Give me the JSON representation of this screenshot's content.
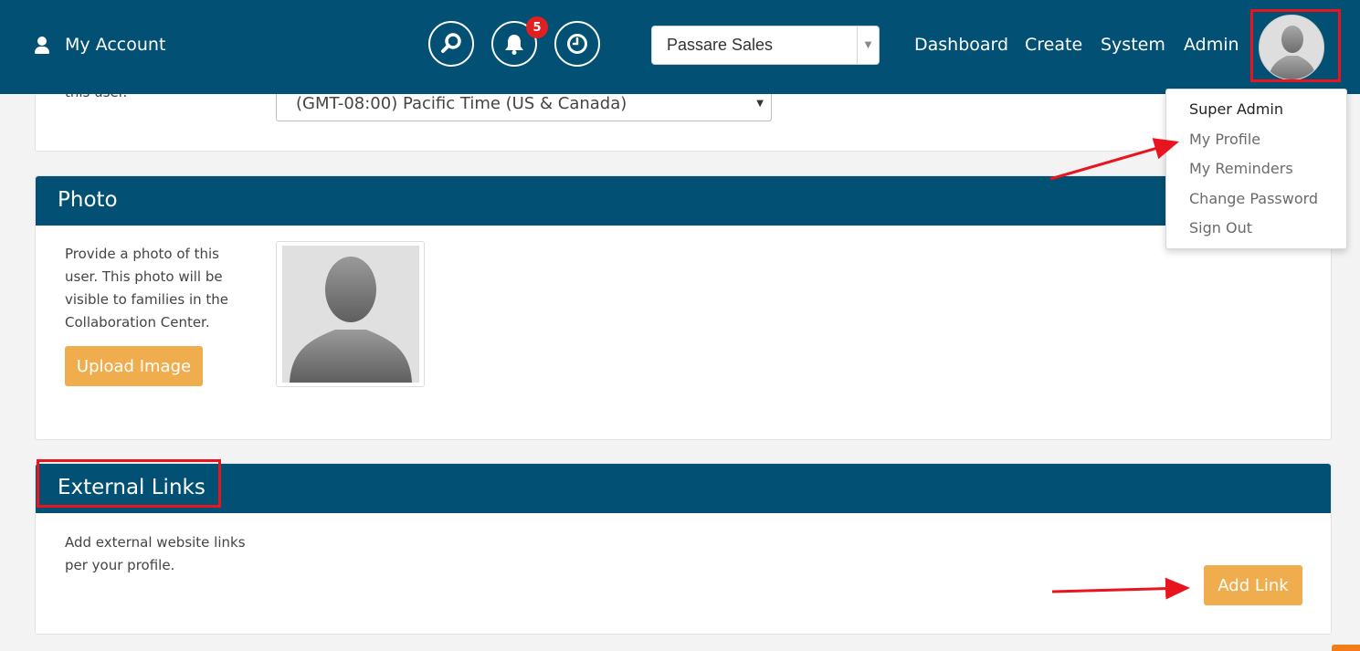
{
  "topnav": {
    "my_account_label": "My Account",
    "notification_count": "5",
    "company_select_value": "Passare Sales",
    "links": [
      "Dashboard",
      "Create",
      "System",
      "Admin"
    ]
  },
  "user_menu": {
    "header": "Super Admin",
    "items": [
      "My Profile",
      "My Reminders",
      "Change Password",
      "Sign Out"
    ]
  },
  "timezone_section": {
    "partial_label": "this user.",
    "timezone_value": "(GMT-08:00) Pacific Time (US & Canada)"
  },
  "photo_section": {
    "title": "Photo",
    "description": "Provide a photo of this user. This photo will be visible to families in the Collaboration Center.",
    "upload_button": "Upload Image"
  },
  "external_links_section": {
    "title": "External Links",
    "description": "Add external website links per your profile.",
    "add_button": "Add Link"
  },
  "colors": {
    "nav_bg": "#025073",
    "accent_orange": "#f0ad4e",
    "highlight_red": "#e8141e"
  }
}
